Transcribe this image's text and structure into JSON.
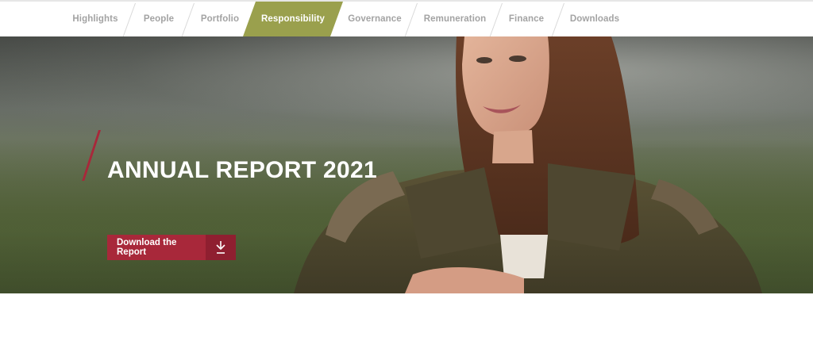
{
  "nav": {
    "items": [
      {
        "label": "Highlights",
        "active": false
      },
      {
        "label": "People",
        "active": false
      },
      {
        "label": "Portfolio",
        "active": false
      },
      {
        "label": "Responsibility",
        "active": true
      },
      {
        "label": "Governance",
        "active": false
      },
      {
        "label": "Remuneration",
        "active": false
      },
      {
        "label": "Finance",
        "active": false
      },
      {
        "label": "Downloads",
        "active": false
      }
    ],
    "active_color": "#9aa04d"
  },
  "hero": {
    "title": "ANNUAL REPORT 2021",
    "download_label": "Download the Report",
    "download_icon": "download-icon",
    "accent_color": "#a8283a"
  }
}
